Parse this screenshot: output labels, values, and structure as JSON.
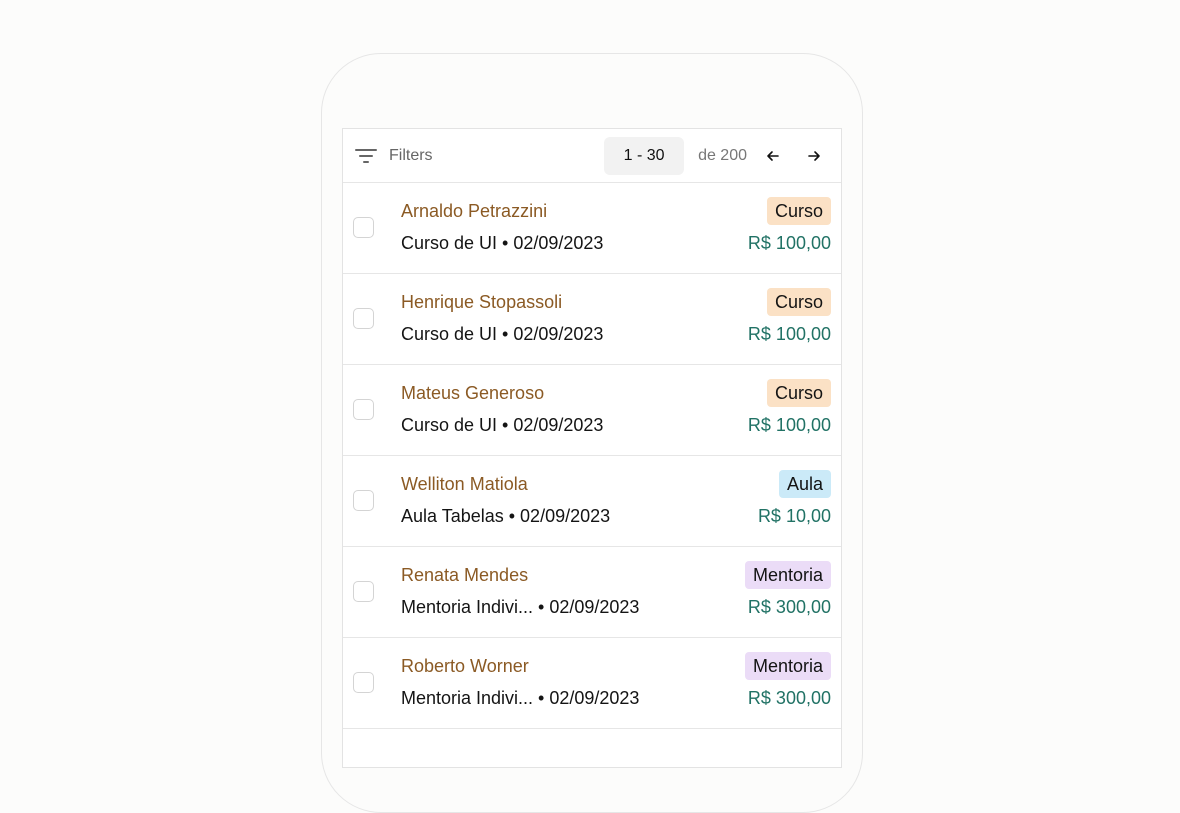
{
  "toolbar": {
    "filters_label": "Filters",
    "range": "1 - 30",
    "total": "de 200",
    "prev_icon": "arrow-left-icon",
    "next_icon": "arrow-right-icon"
  },
  "rows": [
    {
      "name": "Arnaldo Petrazzini",
      "desc": "Curso de UI • 02/09/2023",
      "badge": "Curso",
      "type": "curso",
      "price": "R$ 100,00"
    },
    {
      "name": "Henrique Stopassoli",
      "desc": "Curso de UI • 02/09/2023",
      "badge": "Curso",
      "type": "curso",
      "price": "R$ 100,00"
    },
    {
      "name": "Mateus Generoso",
      "desc": "Curso de UI • 02/09/2023",
      "badge": "Curso",
      "type": "curso",
      "price": "R$ 100,00"
    },
    {
      "name": "Welliton Matiola",
      "desc": "Aula Tabelas • 02/09/2023",
      "badge": "Aula",
      "type": "aula",
      "price": "R$ 10,00"
    },
    {
      "name": "Renata Mendes",
      "desc": "Mentoria Indivi... • 02/09/2023",
      "badge": "Mentoria",
      "type": "mentoria",
      "price": "R$ 300,00"
    },
    {
      "name": "Roberto Worner",
      "desc": "Mentoria Indivi... • 02/09/2023",
      "badge": "Mentoria",
      "type": "mentoria",
      "price": "R$ 300,00"
    }
  ],
  "colors": {
    "name": "#8b5a24",
    "price": "#217265",
    "badge_curso": "#fbe1c5",
    "badge_aula": "#cbeaf8",
    "badge_mentoria": "#ebdcf7"
  }
}
